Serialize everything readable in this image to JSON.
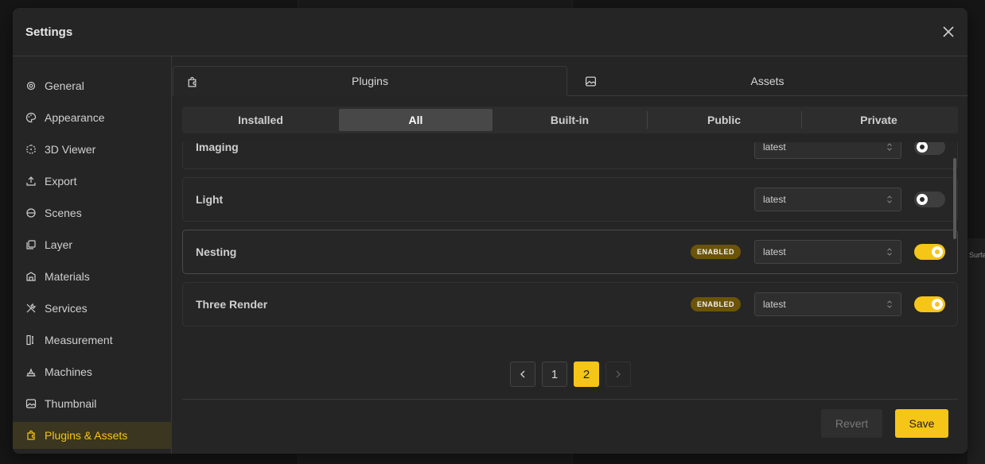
{
  "dialog": {
    "title": "Settings"
  },
  "sidebar": {
    "items": [
      {
        "label": "General",
        "icon": "gear-icon"
      },
      {
        "label": "Appearance",
        "icon": "palette-icon"
      },
      {
        "label": "3D Viewer",
        "icon": "cube-icon"
      },
      {
        "label": "Export",
        "icon": "upload-icon"
      },
      {
        "label": "Scenes",
        "icon": "globe-icon"
      },
      {
        "label": "Layer",
        "icon": "layers-icon"
      },
      {
        "label": "Materials",
        "icon": "building-icon"
      },
      {
        "label": "Services",
        "icon": "tools-icon"
      },
      {
        "label": "Measurement",
        "icon": "ruler-icon"
      },
      {
        "label": "Machines",
        "icon": "machine-icon"
      },
      {
        "label": "Thumbnail",
        "icon": "image-icon"
      },
      {
        "label": "Plugins & Assets",
        "icon": "puzzle-icon"
      }
    ],
    "active_index": 11
  },
  "top_tabs": [
    {
      "label": "Plugins",
      "icon": "puzzle-icon",
      "active": true
    },
    {
      "label": "Assets",
      "icon": "image-icon",
      "active": false
    }
  ],
  "filter_tabs": [
    {
      "label": "Installed"
    },
    {
      "label": "All"
    },
    {
      "label": "Built-in"
    },
    {
      "label": "Public"
    },
    {
      "label": "Private"
    }
  ],
  "filter_active_index": 1,
  "plugins": [
    {
      "name": "Imaging",
      "version": "latest",
      "enabled": false,
      "badge": ""
    },
    {
      "name": "Light",
      "version": "latest",
      "enabled": false,
      "badge": ""
    },
    {
      "name": "Nesting",
      "version": "latest",
      "enabled": true,
      "badge": "ENABLED"
    },
    {
      "name": "Three Render",
      "version": "latest",
      "enabled": true,
      "badge": "ENABLED"
    }
  ],
  "pagination": {
    "pages": [
      "1",
      "2"
    ],
    "current": "2"
  },
  "footer": {
    "revert_label": "Revert",
    "save_label": "Save"
  },
  "colors": {
    "accent": "#f5c518",
    "background": "#252525",
    "badge": "#6b5408"
  },
  "background_text": "Surfa"
}
